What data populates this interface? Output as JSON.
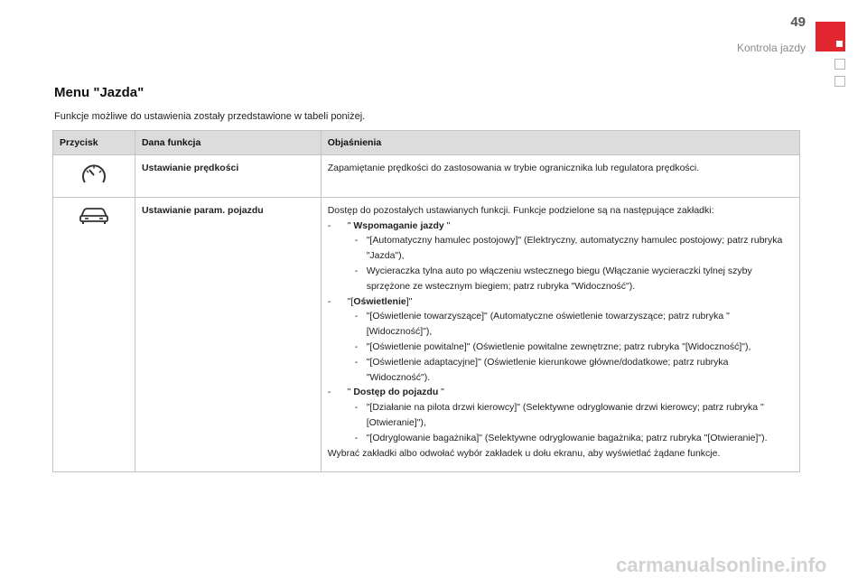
{
  "header": {
    "page_number": "49",
    "section": "Kontrola jazdy"
  },
  "title": "Menu \"Jazda\"",
  "intro": "Funkcje możliwe do ustawienia zostały przedstawione w tabeli poniżej.",
  "table": {
    "headers": [
      "Przycisk",
      "Dana funkcja",
      "Objaśnienia"
    ],
    "rows": [
      {
        "icon": "speedometer-icon",
        "function": "Ustawianie prędkości",
        "explanation": "Zapamiętanie prędkości do zastosowania w trybie ogranicznika lub regulatora prędkości."
      },
      {
        "icon": "car-icon",
        "function": "Ustawianie param. pojazdu",
        "intro": "Dostęp do pozostałych ustawianych funkcji. Funkcje podzielone są na następujące zakładki:",
        "groups": [
          {
            "pre": "\" ",
            "name": "Wspomaganie jazdy",
            "post": " \"",
            "items": [
              "\"[Automatyczny hamulec postojowy]\" (Elektryczny, automatyczny hamulec postojowy; patrz rubryka \"Jazda\"),",
              "Wycieraczka tylna auto po włączeniu wstecznego biegu (Włączanie wycieraczki tylnej szyby sprzężone ze wstecznym biegiem; patrz rubryka \"Widoczność\")."
            ]
          },
          {
            "pre": "\"[",
            "name": "Oświetlenie",
            "post": "]\"",
            "items": [
              "\"[Oświetlenie towarzyszące]\" (Automatyczne oświetlenie towarzyszące; patrz rubryka \"[Widoczność]\"),",
              "\"[Oświetlenie powitalne]\" (Oświetlenie powitalne zewnętrzne; patrz rubryka \"[Widoczność]\"),",
              "\"[Oświetlenie adaptacyjne]\" (Oświetlenie kierunkowe główne/dodatkowe; patrz rubryka \"Widoczność\")."
            ]
          },
          {
            "pre": "\" ",
            "name": "Dostęp do pojazdu",
            "post": " \"",
            "items": [
              "\"[Działanie na pilota drzwi kierowcy]\" (Selektywne odryglowanie drzwi kierowcy; patrz rubryka \"[Otwieranie]\"),",
              "\"[Odryglowanie bagażnika]\" (Selektywne odryglowanie bagażnika; patrz rubryka \"[Otwieranie]\")."
            ]
          }
        ],
        "outro": "Wybrać zakładki albo odwołać wybór zakładek u dołu ekranu, aby wyświetlać żądane funkcje."
      }
    ]
  },
  "watermark": "carmanualsonline.info",
  "colors": {
    "accent_red": "#e1262f",
    "header_bg": "#dcdcdc"
  }
}
